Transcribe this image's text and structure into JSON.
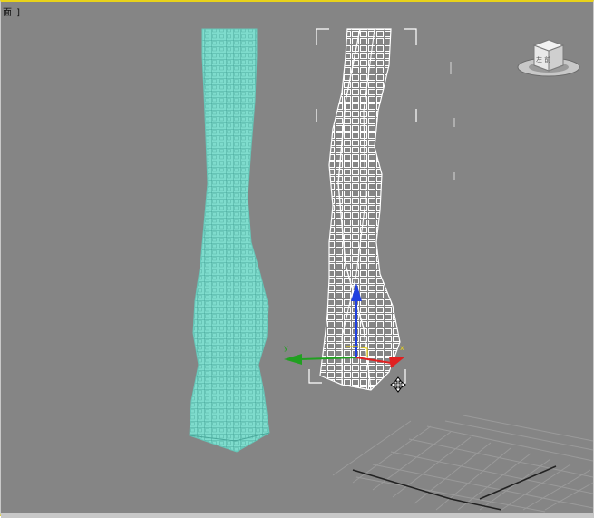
{
  "viewport": {
    "label": "面 ]",
    "background": "#858585",
    "active_border_color": "#e8d21a"
  },
  "viewcube": {
    "face_label": "左 前",
    "icon": "viewcube-icon"
  },
  "objects": [
    {
      "name": "twisted-tower-shaded",
      "display": "shaded-wireframe",
      "color": "#7fe0d0",
      "selected": false
    },
    {
      "name": "twisted-tower-wireframe",
      "display": "wireframe",
      "color": "#ffffff",
      "selected": true
    }
  ],
  "gizmo": {
    "type": "move-transform-gizmo",
    "axes": [
      {
        "axis": "x",
        "color": "#e02020"
      },
      {
        "axis": "y",
        "color": "#20a020"
      },
      {
        "axis": "z",
        "color": "#2040e0"
      }
    ],
    "axis_labels": [
      "x",
      "y"
    ]
  },
  "grid": {
    "color": "#9a9a9a",
    "axis_color": "#222222"
  },
  "colors": {
    "accent": "#e8d21a"
  }
}
